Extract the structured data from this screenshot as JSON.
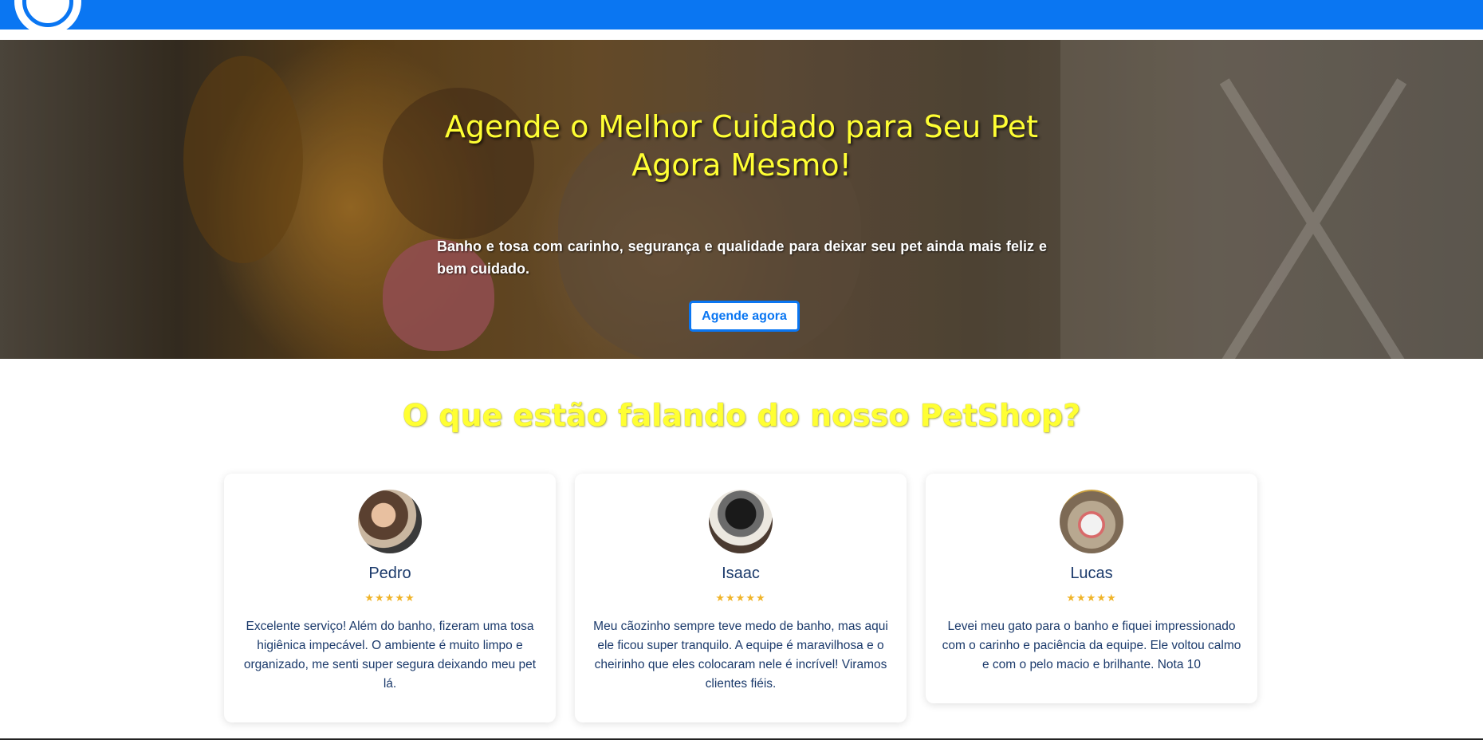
{
  "hero": {
    "title": "Agende o Melhor Cuidado para Seu Pet Agora Mesmo!",
    "subtitle": "Banho e tosa com carinho, segurança e qualidade para deixar seu pet ainda mais feliz e bem cuidado.",
    "cta_label": "Agende agora"
  },
  "testimonials": {
    "title": "O que estão falando do nosso PetShop?",
    "items": [
      {
        "name": "Pedro",
        "stars": "★★★★★",
        "text": "Excelente serviço! Além do banho, fizeram uma tosa higiênica impecável. O ambiente é muito limpo e organizado, me senti super segura deixando meu pet lá."
      },
      {
        "name": "Isaac",
        "stars": "★★★★★",
        "text": "Meu cãozinho sempre teve medo de banho, mas aqui ele ficou super tranquilo. A equipe é maravilhosa e o cheirinho que eles colocaram nele é incrível! Viramos clientes fiéis."
      },
      {
        "name": "Lucas",
        "stars": "★★★★★",
        "text": "Levei meu gato para o banho e fiquei impressionado com o carinho e paciência da equipe. Ele voltou calmo e com o pelo macio e brilhante. Nota 10"
      }
    ]
  },
  "colors": {
    "header": "#0a76f2",
    "accent_yellow": "#ffff33",
    "text_navy": "#1b3a6b",
    "star": "#f0b429"
  }
}
